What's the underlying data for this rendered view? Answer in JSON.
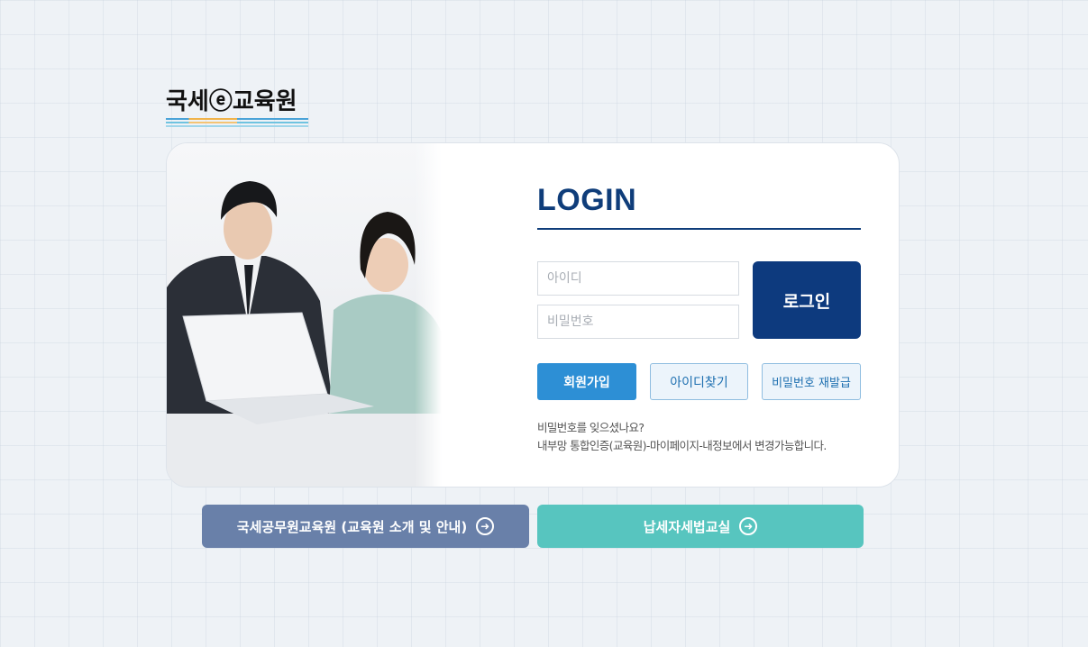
{
  "logo": {
    "text": "국세ⓔ교육원"
  },
  "login": {
    "title": "LOGIN",
    "id_placeholder": "아이디",
    "pw_placeholder": "비밀번호",
    "login_label": "로그인",
    "join_label": "회원가입",
    "find_id_label": "아이디찾기",
    "reset_pw_label": "비밀번호 재발급",
    "notice_line1": "비밀번호를 잊으셨나요?",
    "notice_line2": "내부망 통합인증(교육원)-마이페이지-내정보에서 변경가능합니다."
  },
  "bottom": {
    "intro_label": "국세공무원교육원 (교육원 소개 및 안내)",
    "tax_label": "납세자세법교실"
  },
  "colors": {
    "primary_navy": "#0d3a7e",
    "join_blue": "#2d8fd5",
    "intro_slate": "#6980a9",
    "tax_teal": "#57c5bf"
  },
  "icons": [
    "arrow-right-circle-icon"
  ]
}
